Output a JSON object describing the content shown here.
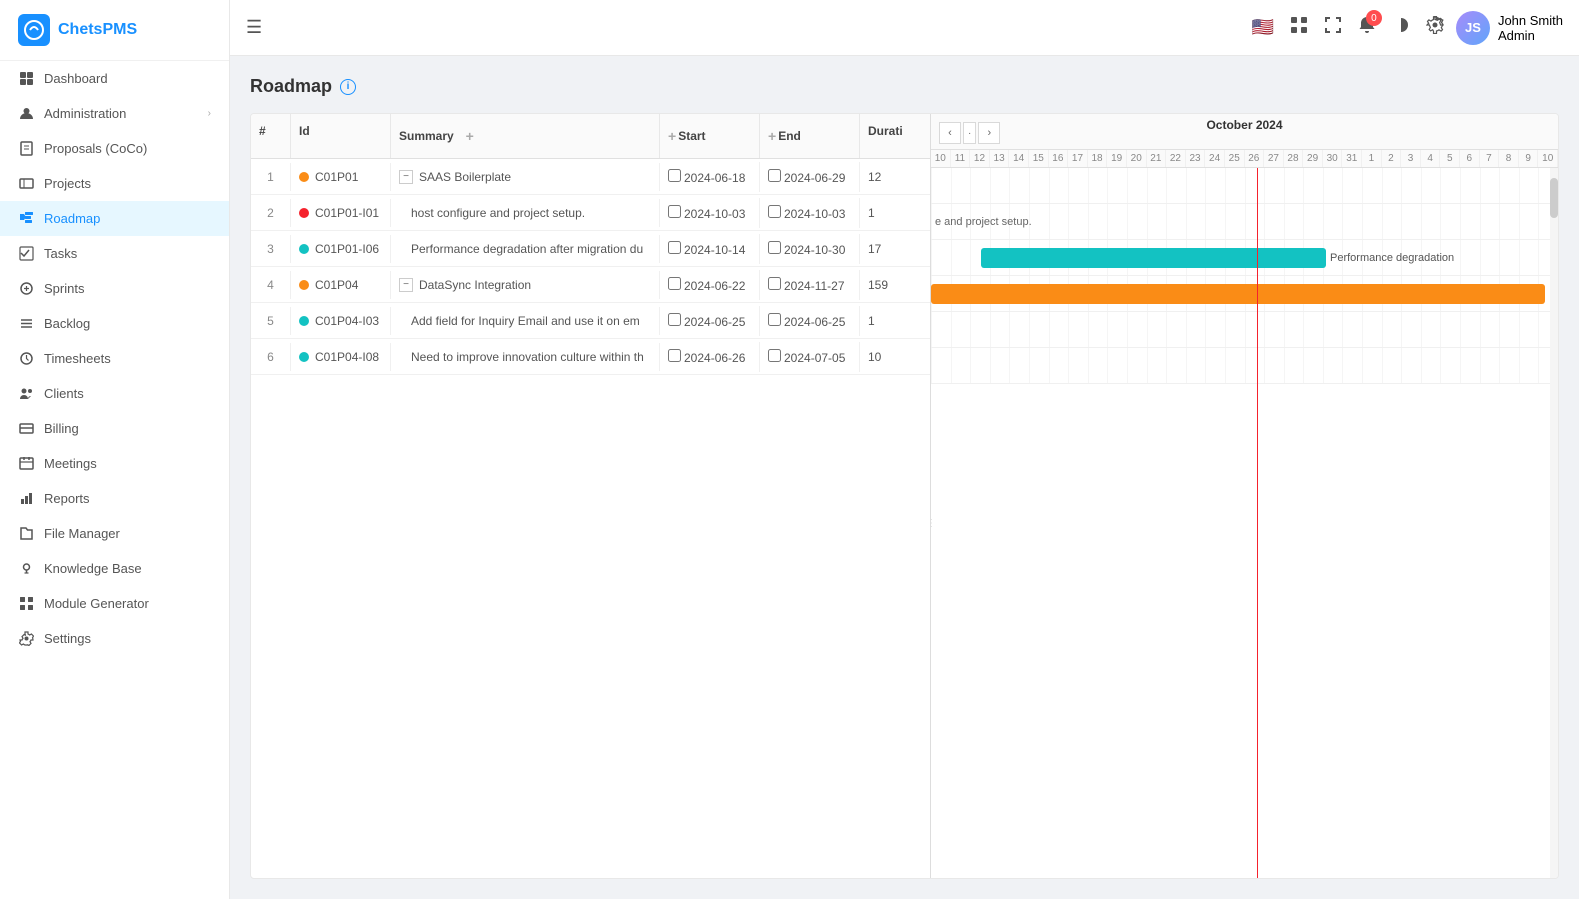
{
  "app": {
    "logo_text": "ChetsPMS",
    "logo_initial": "C"
  },
  "sidebar": {
    "items": [
      {
        "id": "dashboard",
        "label": "Dashboard",
        "icon": "dashboard"
      },
      {
        "id": "administration",
        "label": "Administration",
        "icon": "admin",
        "has_arrow": true
      },
      {
        "id": "proposals",
        "label": "Proposals (CoCo)",
        "icon": "proposals"
      },
      {
        "id": "projects",
        "label": "Projects",
        "icon": "projects"
      },
      {
        "id": "roadmap",
        "label": "Roadmap",
        "icon": "roadmap",
        "active": true
      },
      {
        "id": "tasks",
        "label": "Tasks",
        "icon": "tasks"
      },
      {
        "id": "sprints",
        "label": "Sprints",
        "icon": "sprints"
      },
      {
        "id": "backlog",
        "label": "Backlog",
        "icon": "backlog"
      },
      {
        "id": "timesheets",
        "label": "Timesheets",
        "icon": "timesheets"
      },
      {
        "id": "clients",
        "label": "Clients",
        "icon": "clients"
      },
      {
        "id": "billing",
        "label": "Billing",
        "icon": "billing"
      },
      {
        "id": "meetings",
        "label": "Meetings",
        "icon": "meetings"
      },
      {
        "id": "reports",
        "label": "Reports",
        "icon": "reports"
      },
      {
        "id": "file-manager",
        "label": "File Manager",
        "icon": "files"
      },
      {
        "id": "knowledge-base",
        "label": "Knowledge Base",
        "icon": "knowledge"
      },
      {
        "id": "module-generator",
        "label": "Module Generator",
        "icon": "module"
      },
      {
        "id": "settings",
        "label": "Settings",
        "icon": "settings"
      }
    ]
  },
  "topbar": {
    "hamburger_label": "☰",
    "notification_count": "0",
    "user": {
      "name": "John Smith",
      "role": "Admin",
      "initials": "JS"
    }
  },
  "page": {
    "title": "Roadmap"
  },
  "table": {
    "columns": [
      "#",
      "Id",
      "Summary",
      "",
      "Start",
      "End",
      "Durati"
    ],
    "rows": [
      {
        "num": "1",
        "id": "C01P01",
        "id_dot": "orange",
        "summary": "SAAS Boilerplate",
        "collapsible": true,
        "start": "2024-06-18",
        "end": "2024-06-29",
        "duration": "12"
      },
      {
        "num": "2",
        "id": "C01P01-I01",
        "id_dot": "red",
        "summary": "host configure and project setup.",
        "collapsible": false,
        "indent": true,
        "start": "2024-10-03",
        "end": "2024-10-03",
        "duration": "1"
      },
      {
        "num": "3",
        "id": "C01P01-I06",
        "id_dot": "cyan",
        "summary": "Performance degradation after migration du",
        "collapsible": false,
        "indent": true,
        "start": "2024-10-14",
        "end": "2024-10-30",
        "duration": "17"
      },
      {
        "num": "4",
        "id": "C01P04",
        "id_dot": "orange",
        "summary": "DataSync Integration",
        "collapsible": true,
        "start": "2024-06-22",
        "end": "2024-11-27",
        "duration": "159"
      },
      {
        "num": "5",
        "id": "C01P04-I03",
        "id_dot": "cyan",
        "summary": "Add field for Inquiry Email and use it on em",
        "collapsible": false,
        "indent": true,
        "start": "2024-06-25",
        "end": "2024-06-25",
        "duration": "1"
      },
      {
        "num": "6",
        "id": "C01P04-I08",
        "id_dot": "cyan",
        "summary": "Need to improve innovation culture within th",
        "collapsible": false,
        "indent": true,
        "start": "2024-06-26",
        "end": "2024-07-05",
        "duration": "10"
      }
    ]
  },
  "gantt": {
    "month_label": "October 2024",
    "days": [
      "10",
      "11",
      "12",
      "13",
      "14",
      "15",
      "16",
      "17",
      "18",
      "19",
      "20",
      "21",
      "22",
      "23",
      "24",
      "25",
      "26",
      "27",
      "28",
      "29",
      "30",
      "31",
      "1",
      "2",
      "3",
      "4",
      "5",
      "6",
      "7",
      "8",
      "9",
      "10"
    ],
    "bars": [
      {
        "row": 2,
        "label": "Performance degradation",
        "color": "cyan",
        "left_pct": 8,
        "width_pct": 55
      },
      {
        "row": 3,
        "label": "",
        "color": "orange",
        "left_pct": 0,
        "width_pct": 100
      }
    ],
    "row_labels": [
      {
        "row": 1,
        "text": "e and project setup."
      }
    ]
  }
}
